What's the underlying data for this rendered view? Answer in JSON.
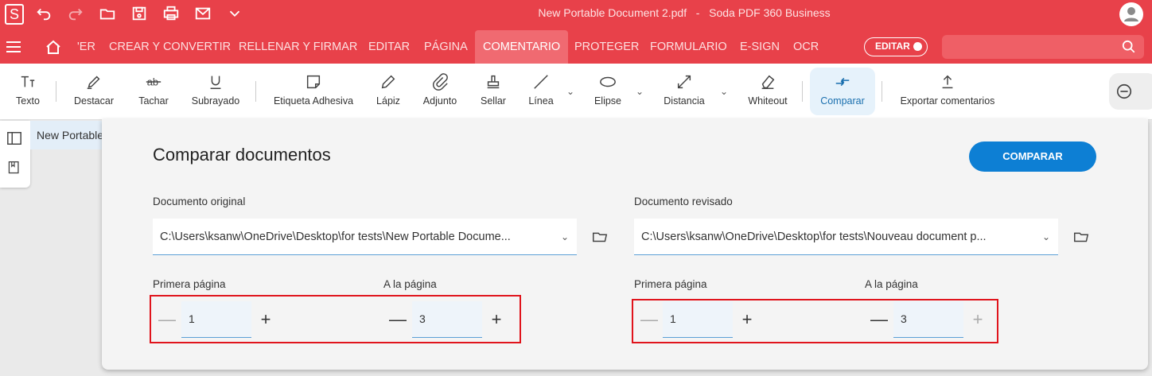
{
  "titlebar": {
    "logo": "S",
    "document_title": "New Portable Document 2.pdf",
    "separator": "-",
    "app_name": "Soda PDF 360 Business"
  },
  "menubar": {
    "tabs": [
      {
        "label": "'ER"
      },
      {
        "label": "CREAR Y CONVERTIR"
      },
      {
        "label": "RELLENAR Y FIRMAR"
      },
      {
        "label": "EDITAR"
      },
      {
        "label": "PÁGINA"
      },
      {
        "label": "COMENTARIO",
        "active": true
      },
      {
        "label": "PROTEGER"
      },
      {
        "label": "FORMULARIO"
      },
      {
        "label": "E-SIGN"
      },
      {
        "label": "OCR"
      }
    ],
    "edit_toggle_label": "EDITAR",
    "search_placeholder": ""
  },
  "toolbar": {
    "tools": [
      {
        "label": "Texto",
        "icon": "text-icon"
      },
      {
        "label": "Destacar",
        "icon": "highlighter-icon"
      },
      {
        "label": "Tachar",
        "icon": "strikethrough-icon"
      },
      {
        "label": "Subrayado",
        "icon": "underline-icon"
      },
      {
        "label": "Etiqueta Adhesiva",
        "icon": "sticky-note-icon"
      },
      {
        "label": "Lápiz",
        "icon": "pencil-icon"
      },
      {
        "label": "Adjunto",
        "icon": "paperclip-icon"
      },
      {
        "label": "Sellar",
        "icon": "stamp-icon"
      },
      {
        "label": "Línea",
        "icon": "line-icon"
      },
      {
        "label": "Elipse",
        "icon": "ellipse-icon"
      },
      {
        "label": "Distancia",
        "icon": "distance-icon"
      },
      {
        "label": "Whiteout",
        "icon": "eraser-icon"
      },
      {
        "label": "Comparar",
        "icon": "compare-icon",
        "active": true
      },
      {
        "label": "Exportar comentarios",
        "icon": "export-icon"
      }
    ]
  },
  "document_tab": {
    "label": "New Portable"
  },
  "dialog": {
    "title": "Comparar documentos",
    "compare_button": "COMPARAR",
    "original": {
      "label": "Documento original",
      "path": "C:\\Users\\ksanw\\OneDrive\\Desktop\\for tests\\New Portable Docume...",
      "first_page_label": "Primera página",
      "first_page": "1",
      "to_page_label": "A la página",
      "to_page": "3"
    },
    "revised": {
      "label": "Documento revisado",
      "path": "C:\\Users\\ksanw\\OneDrive\\Desktop\\for tests\\Nouveau document p...",
      "first_page_label": "Primera página",
      "first_page": "1",
      "to_page_label": "A la página",
      "to_page": "3"
    },
    "minus_glyph": "—",
    "plus_glyph": "+"
  },
  "colors": {
    "brand_red": "#e8414a",
    "accent_blue": "#0d7fd4",
    "highlight_red": "#e0141c"
  }
}
